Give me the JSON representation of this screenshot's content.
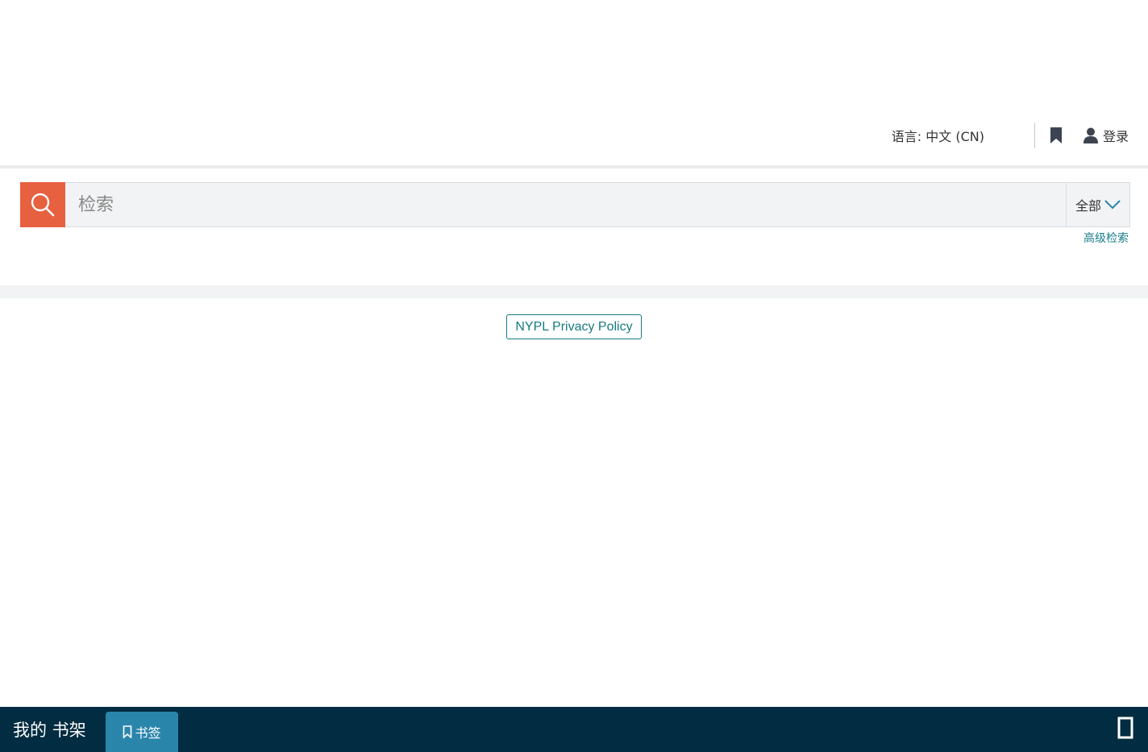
{
  "header": {
    "language_label": "语言: 中文 (CN)",
    "login_label": "登录"
  },
  "search": {
    "placeholder": "检索",
    "scope_label": "全部",
    "advanced_label": "高级检索"
  },
  "footer": {
    "privacy_label": "NYPL Privacy Policy"
  },
  "bottom_bar": {
    "title": "我的 书架",
    "tab_bookmarks": "书签"
  },
  "colors": {
    "search_button": "#e76040",
    "link": "#1a7e8c",
    "bottom_bar": "#022c41",
    "active_tab": "#2a85ab"
  },
  "icons": [
    "bookmark-icon",
    "user-icon",
    "search-icon",
    "chevron-down-icon",
    "bookmark-outline-icon",
    "expand-icon"
  ]
}
